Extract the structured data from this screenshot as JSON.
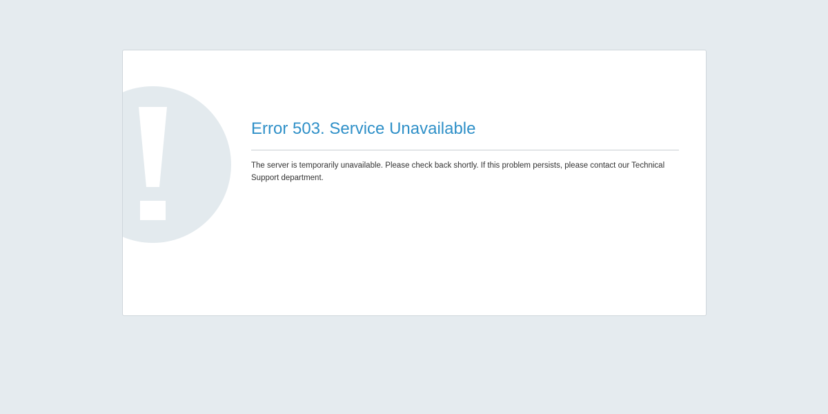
{
  "error_page": {
    "title": "Error 503. Service Unavailable",
    "message": "The server is temporarily unavailable. Please check back shortly. If this problem persists, please contact our Technical Support department.",
    "icon": "exclamation-icon",
    "colors": {
      "background": "#e5ebef",
      "card": "#ffffff",
      "title": "#2f90c8",
      "icon_circle": "#e3eaee",
      "text": "#333333"
    }
  }
}
